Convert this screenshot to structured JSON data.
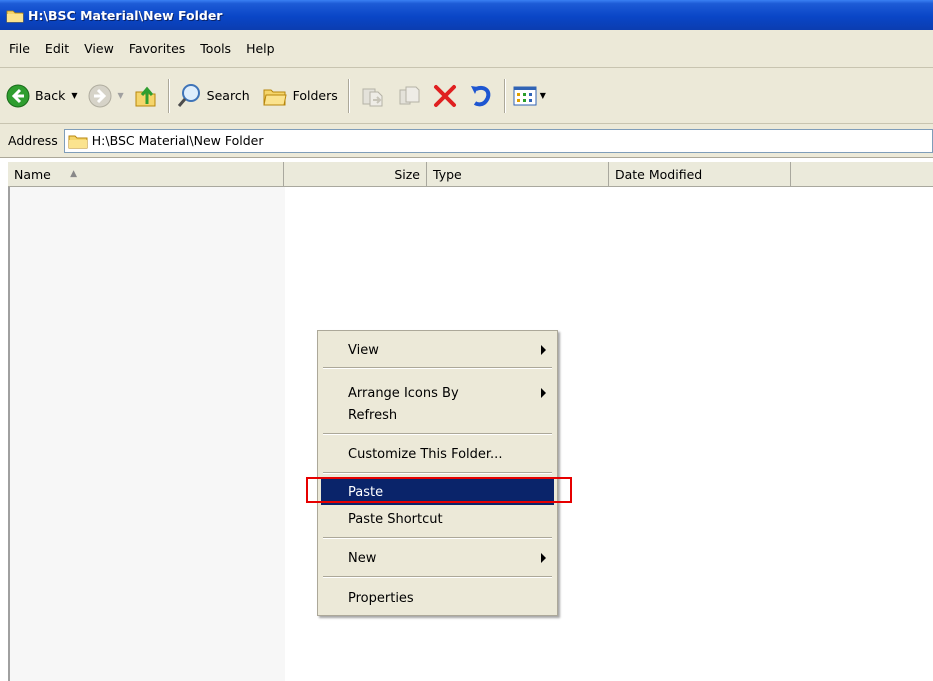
{
  "window": {
    "title": "H:\\BSC Material\\New Folder"
  },
  "menubar": {
    "items": [
      "File",
      "Edit",
      "View",
      "Favorites",
      "Tools",
      "Help"
    ]
  },
  "toolbar": {
    "back_label": "Back",
    "search_label": "Search",
    "folders_label": "Folders",
    "icons": [
      "back-arrow-icon",
      "forward-arrow-icon",
      "up-folder-icon",
      "search-icon",
      "folders-icon",
      "move-to-icon",
      "copy-to-icon",
      "delete-icon",
      "undo-icon",
      "views-icon"
    ]
  },
  "address": {
    "label": "Address",
    "value": "H:\\BSC Material\\New Folder"
  },
  "columns": {
    "name": "Name",
    "size": "Size",
    "type": "Type",
    "date": "Date Modified"
  },
  "context_menu": {
    "view": "View",
    "arrange": "Arrange Icons By",
    "refresh": "Refresh",
    "customize": "Customize This Folder...",
    "paste": "Paste",
    "paste_shortcut": "Paste Shortcut",
    "new": "New",
    "properties": "Properties",
    "highlighted_item": "Paste"
  },
  "colors": {
    "titlebar": "#0a46c7",
    "menu_highlight": "#0a246a",
    "annotation": "#e60000",
    "chrome": "#ece9d8"
  }
}
